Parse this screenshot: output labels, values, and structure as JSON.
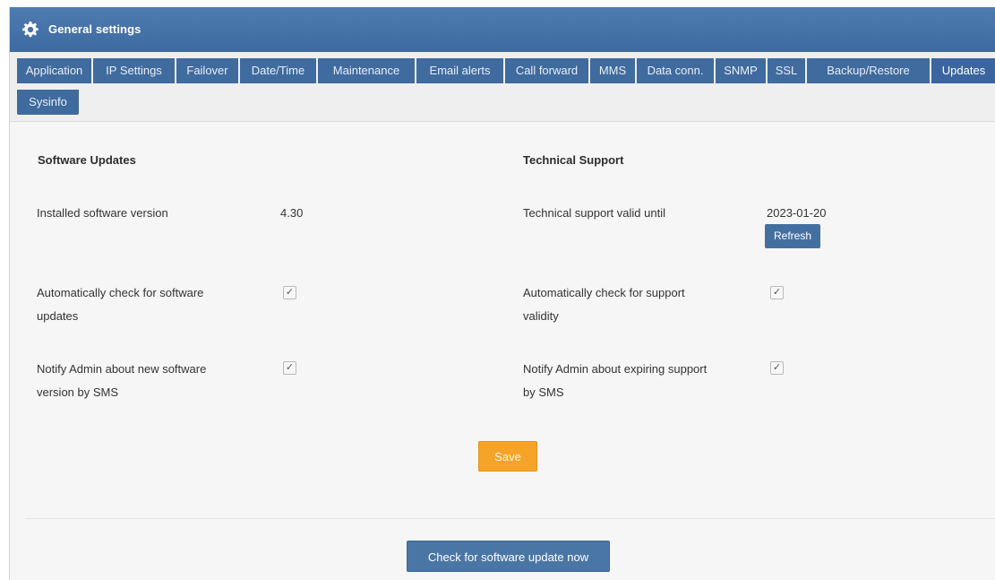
{
  "header": {
    "title": "General settings",
    "icon": "gear-icon"
  },
  "tabs": [
    {
      "label": "Application"
    },
    {
      "label": "IP Settings"
    },
    {
      "label": "Failover"
    },
    {
      "label": "Date/Time"
    },
    {
      "label": "Maintenance"
    },
    {
      "label": "Email alerts"
    },
    {
      "label": "Call forward"
    },
    {
      "label": "MMS"
    },
    {
      "label": "Data conn."
    },
    {
      "label": "SNMP"
    },
    {
      "label": "SSL"
    },
    {
      "label": "Backup/Restore"
    },
    {
      "label": "Updates",
      "active": true
    },
    {
      "label": "Sysinfo"
    }
  ],
  "software": {
    "heading": "Software Updates",
    "installed_label": "Installed software version",
    "installed_value": "4.30",
    "auto_check_label_1": "Automatically check for software",
    "auto_check_label_2": "updates",
    "auto_check_checked": true,
    "notify_label_1": "Notify Admin about new software",
    "notify_label_2": "version by SMS",
    "notify_checked": true
  },
  "support": {
    "heading": "Technical Support",
    "valid_label": "Technical support valid until",
    "valid_value": "2023-01-20",
    "refresh_label": "Refresh",
    "auto_check_label_1": "Automatically check for support",
    "auto_check_label_2": "validity",
    "auto_check_checked": true,
    "notify_label_1": "Notify Admin about expiring support",
    "notify_label_2": "by SMS",
    "notify_checked": true
  },
  "actions": {
    "save_label": "Save",
    "check_now_label": "Check for software update now"
  },
  "colors": {
    "header": "#3d6aa0",
    "tab": "#3f6b9f",
    "save": "#f5a429",
    "primary_button": "#4a76a6"
  },
  "checkmark": "✓"
}
